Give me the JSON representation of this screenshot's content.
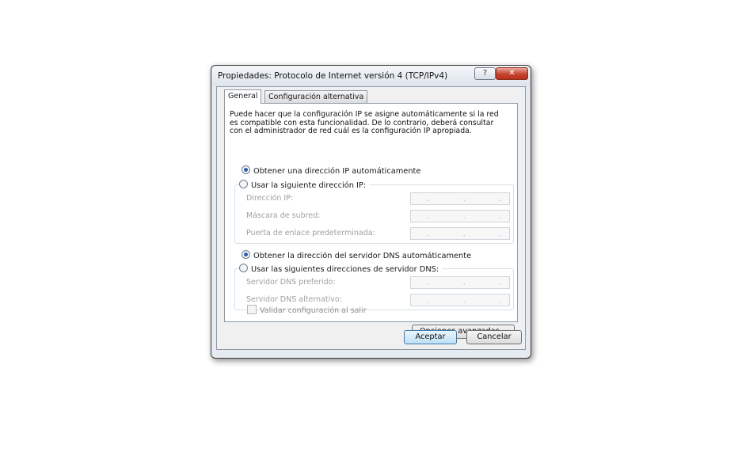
{
  "window": {
    "title": "Propiedades: Protocolo de Internet versión 4 (TCP/IPv4)",
    "help_label": "?",
    "close_label": "✕"
  },
  "tabs": [
    {
      "label": "General",
      "selected": true
    },
    {
      "label": "Configuración alternativa",
      "selected": false
    }
  ],
  "general": {
    "description": "Puede hacer que la configuración IP se asigne automáticamente si la red es compatible con esta funcionalidad. De lo contrario, deberá consultar con el administrador de red cuál es la configuración IP apropiada.",
    "ip_auto_label": "Obtener una dirección IP automáticamente",
    "ip_manual_label": "Usar la siguiente dirección IP:",
    "ip_fields": [
      {
        "label": "Dirección IP:",
        "value": ". . ."
      },
      {
        "label": "Máscara de subred:",
        "value": ". . ."
      },
      {
        "label": "Puerta de enlace predeterminada:",
        "value": ". . ."
      }
    ],
    "dns_auto_label": "Obtener la dirección del servidor DNS automáticamente",
    "dns_manual_label": "Usar las siguientes direcciones de servidor DNS:",
    "dns_fields": [
      {
        "label": "Servidor DNS preferido:",
        "value": ". . ."
      },
      {
        "label": "Servidor DNS alternativo:",
        "value": ". . ."
      }
    ],
    "validate_label": "Validar configuración al salir",
    "advanced_label": "Opciones avanzadas..."
  },
  "buttons": {
    "ok_label": "Aceptar",
    "cancel_label": "Cancelar"
  }
}
